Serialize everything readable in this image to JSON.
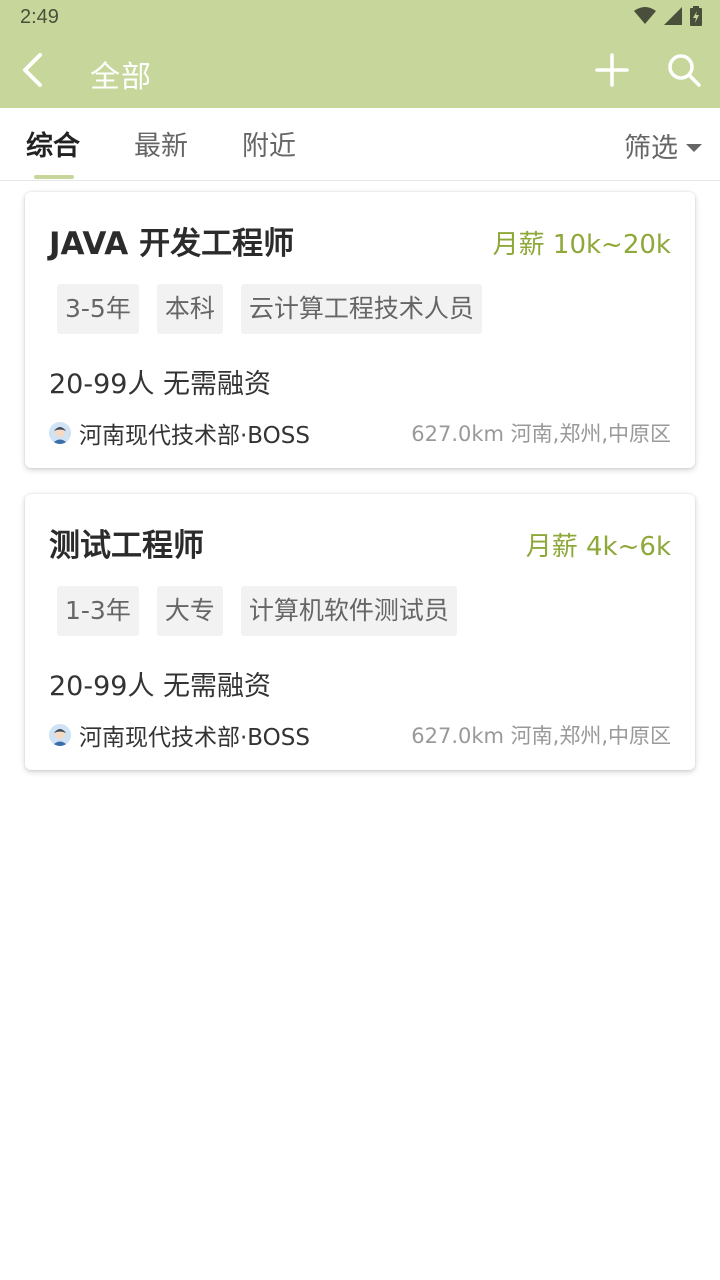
{
  "status_bar": {
    "time": "2:49",
    "icons": [
      "wifi-icon",
      "signal-icon",
      "battery-icon"
    ]
  },
  "app_bar": {
    "title": "全部",
    "back_icon": "chevron-left-icon",
    "add_icon": "plus-icon",
    "search_icon": "search-icon",
    "background": "#c7d79b"
  },
  "tabs": [
    {
      "label": "综合",
      "active": true
    },
    {
      "label": "最新",
      "active": false
    },
    {
      "label": "附近",
      "active": false
    }
  ],
  "filter": {
    "label": "筛选",
    "icon": "caret-down-icon"
  },
  "jobs": [
    {
      "title": "JAVA 开发工程师",
      "salary": "月薪 10k~20k",
      "tags": [
        "3-5年",
        "本科",
        "云计算工程技术人员"
      ],
      "company_info": "20-99人 无需融资",
      "poster": "河南现代技术部·BOSS",
      "location": "627.0km 河南,郑州,中原区"
    },
    {
      "title": "测试工程师",
      "salary": "月薪 4k~6k",
      "tags": [
        "1-3年",
        "大专",
        "计算机软件测试员"
      ],
      "company_info": "20-99人 无需融资",
      "poster": "河南现代技术部·BOSS",
      "location": "627.0km 河南,郑州,中原区"
    }
  ],
  "colors": {
    "accent": "#c7d79b",
    "salary": "#8ea83a"
  }
}
